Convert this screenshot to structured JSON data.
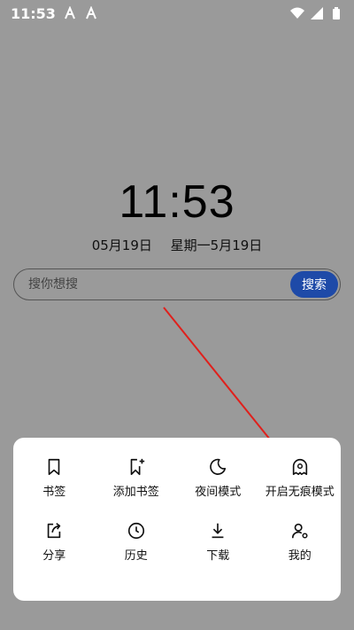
{
  "status_bar": {
    "time": "11:53",
    "left_icons": [
      "a-app-icon",
      "a-app-icon"
    ],
    "right_icons": [
      "wifi-icon",
      "signal-icon",
      "battery-icon"
    ]
  },
  "clock": {
    "time": "11:53",
    "date": "05月19日",
    "lunar": "星期一5月19日"
  },
  "search": {
    "placeholder": "搜你想搜",
    "button_label": "搜索",
    "button_color": "#1e4aa8"
  },
  "menu": {
    "items": [
      {
        "label": "书签",
        "icon": "bookmark-icon"
      },
      {
        "label": "添加书签",
        "icon": "add-bookmark-icon"
      },
      {
        "label": "夜间模式",
        "icon": "moon-icon"
      },
      {
        "label": "开启无痕模式",
        "icon": "incognito-icon"
      },
      {
        "label": "分享",
        "icon": "share-icon"
      },
      {
        "label": "历史",
        "icon": "history-icon"
      },
      {
        "label": "下载",
        "icon": "download-icon"
      },
      {
        "label": "我的",
        "icon": "user-settings-icon"
      }
    ]
  },
  "annotation": {
    "arrow_color": "#e0201c"
  }
}
